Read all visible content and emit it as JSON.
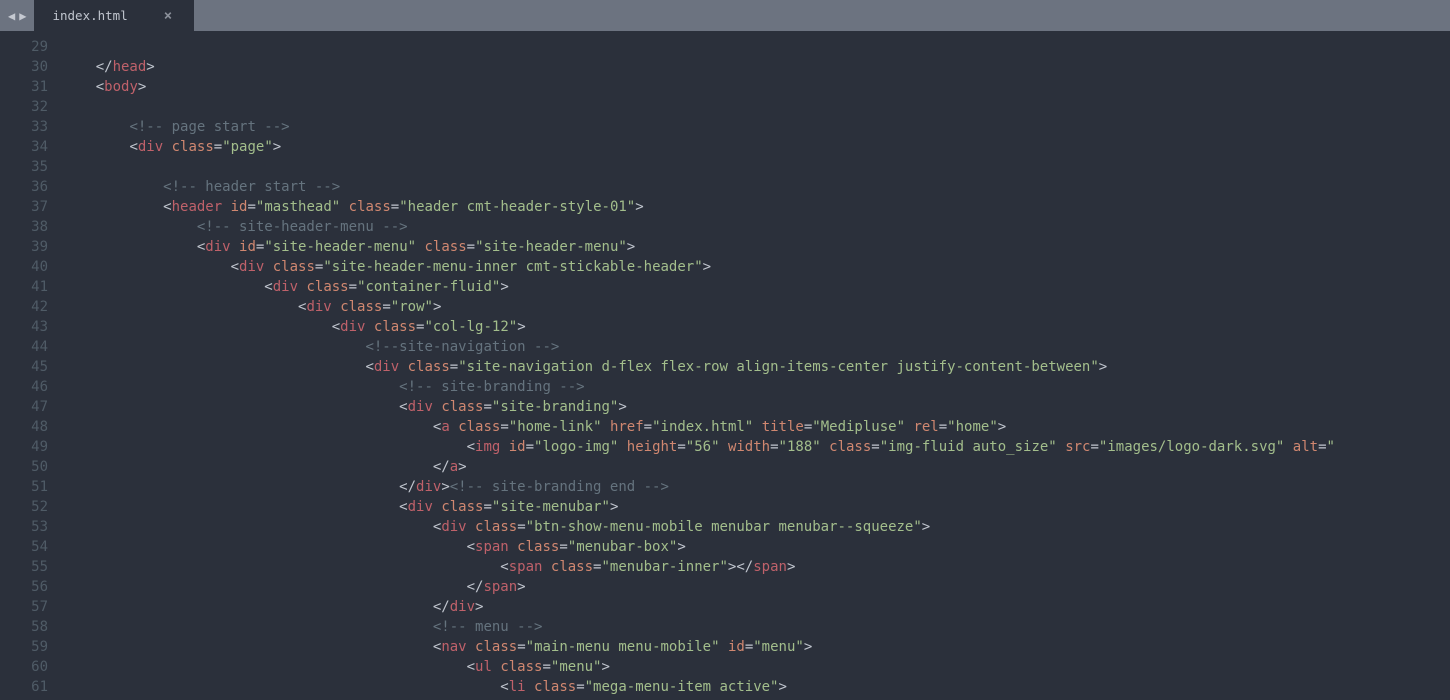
{
  "tab": {
    "title": "index.html"
  },
  "lines": [
    {
      "n": 29,
      "segs": []
    },
    {
      "n": 30,
      "segs": [
        {
          "t": "    ",
          "c": "p"
        },
        {
          "t": "</",
          "c": "p"
        },
        {
          "t": "head",
          "c": "tag"
        },
        {
          "t": ">",
          "c": "p"
        }
      ]
    },
    {
      "n": 31,
      "segs": [
        {
          "t": "    ",
          "c": "p"
        },
        {
          "t": "<",
          "c": "p"
        },
        {
          "t": "body",
          "c": "tag"
        },
        {
          "t": ">",
          "c": "p"
        }
      ]
    },
    {
      "n": 32,
      "segs": []
    },
    {
      "n": 33,
      "segs": [
        {
          "t": "        ",
          "c": "p"
        },
        {
          "t": "<!-- page start -->",
          "c": "cm"
        }
      ]
    },
    {
      "n": 34,
      "segs": [
        {
          "t": "        ",
          "c": "p"
        },
        {
          "t": "<",
          "c": "p"
        },
        {
          "t": "div",
          "c": "tag"
        },
        {
          "t": " ",
          "c": "p"
        },
        {
          "t": "class",
          "c": "attr"
        },
        {
          "t": "=",
          "c": "op"
        },
        {
          "t": "\"page\"",
          "c": "str"
        },
        {
          "t": ">",
          "c": "p"
        }
      ]
    },
    {
      "n": 35,
      "segs": []
    },
    {
      "n": 36,
      "segs": [
        {
          "t": "            ",
          "c": "p"
        },
        {
          "t": "<!-- header start -->",
          "c": "cm"
        }
      ]
    },
    {
      "n": 37,
      "segs": [
        {
          "t": "            ",
          "c": "p"
        },
        {
          "t": "<",
          "c": "p"
        },
        {
          "t": "header",
          "c": "tag"
        },
        {
          "t": " ",
          "c": "p"
        },
        {
          "t": "id",
          "c": "attr"
        },
        {
          "t": "=",
          "c": "op"
        },
        {
          "t": "\"masthead\"",
          "c": "str"
        },
        {
          "t": " ",
          "c": "p"
        },
        {
          "t": "class",
          "c": "attr"
        },
        {
          "t": "=",
          "c": "op"
        },
        {
          "t": "\"header cmt-header-style-01\"",
          "c": "str"
        },
        {
          "t": ">",
          "c": "p"
        }
      ]
    },
    {
      "n": 38,
      "segs": [
        {
          "t": "                ",
          "c": "p"
        },
        {
          "t": "<!-- site-header-menu -->",
          "c": "cm"
        }
      ]
    },
    {
      "n": 39,
      "segs": [
        {
          "t": "                ",
          "c": "p"
        },
        {
          "t": "<",
          "c": "p"
        },
        {
          "t": "div",
          "c": "tag"
        },
        {
          "t": " ",
          "c": "p"
        },
        {
          "t": "id",
          "c": "attr"
        },
        {
          "t": "=",
          "c": "op"
        },
        {
          "t": "\"site-header-menu\"",
          "c": "str"
        },
        {
          "t": " ",
          "c": "p"
        },
        {
          "t": "class",
          "c": "attr"
        },
        {
          "t": "=",
          "c": "op"
        },
        {
          "t": "\"site-header-menu\"",
          "c": "str"
        },
        {
          "t": ">",
          "c": "p"
        }
      ]
    },
    {
      "n": 40,
      "segs": [
        {
          "t": "                    ",
          "c": "p"
        },
        {
          "t": "<",
          "c": "p"
        },
        {
          "t": "div",
          "c": "tag"
        },
        {
          "t": " ",
          "c": "p"
        },
        {
          "t": "class",
          "c": "attr"
        },
        {
          "t": "=",
          "c": "op"
        },
        {
          "t": "\"site-header-menu-inner cmt-stickable-header\"",
          "c": "str"
        },
        {
          "t": ">",
          "c": "p"
        }
      ]
    },
    {
      "n": 41,
      "segs": [
        {
          "t": "                        ",
          "c": "p"
        },
        {
          "t": "<",
          "c": "p"
        },
        {
          "t": "div",
          "c": "tag"
        },
        {
          "t": " ",
          "c": "p"
        },
        {
          "t": "class",
          "c": "attr"
        },
        {
          "t": "=",
          "c": "op"
        },
        {
          "t": "\"container-fluid\"",
          "c": "str"
        },
        {
          "t": ">",
          "c": "p"
        }
      ]
    },
    {
      "n": 42,
      "segs": [
        {
          "t": "                            ",
          "c": "p"
        },
        {
          "t": "<",
          "c": "p"
        },
        {
          "t": "div",
          "c": "tag"
        },
        {
          "t": " ",
          "c": "p"
        },
        {
          "t": "class",
          "c": "attr"
        },
        {
          "t": "=",
          "c": "op"
        },
        {
          "t": "\"row\"",
          "c": "str"
        },
        {
          "t": ">",
          "c": "p"
        }
      ]
    },
    {
      "n": 43,
      "segs": [
        {
          "t": "                                ",
          "c": "p"
        },
        {
          "t": "<",
          "c": "p"
        },
        {
          "t": "div",
          "c": "tag"
        },
        {
          "t": " ",
          "c": "p"
        },
        {
          "t": "class",
          "c": "attr"
        },
        {
          "t": "=",
          "c": "op"
        },
        {
          "t": "\"col-lg-12\"",
          "c": "str"
        },
        {
          "t": ">",
          "c": "p"
        }
      ]
    },
    {
      "n": 44,
      "segs": [
        {
          "t": "                                    ",
          "c": "p"
        },
        {
          "t": "<!--site-navigation -->",
          "c": "cm"
        }
      ]
    },
    {
      "n": 45,
      "segs": [
        {
          "t": "                                    ",
          "c": "p"
        },
        {
          "t": "<",
          "c": "p"
        },
        {
          "t": "div",
          "c": "tag"
        },
        {
          "t": " ",
          "c": "p"
        },
        {
          "t": "class",
          "c": "attr"
        },
        {
          "t": "=",
          "c": "op"
        },
        {
          "t": "\"site-navigation d-flex flex-row align-items-center justify-content-between\"",
          "c": "str"
        },
        {
          "t": ">",
          "c": "p"
        }
      ]
    },
    {
      "n": 46,
      "segs": [
        {
          "t": "                                        ",
          "c": "p"
        },
        {
          "t": "<!-- site-branding -->",
          "c": "cm"
        }
      ]
    },
    {
      "n": 47,
      "segs": [
        {
          "t": "                                        ",
          "c": "p"
        },
        {
          "t": "<",
          "c": "p"
        },
        {
          "t": "div",
          "c": "tag"
        },
        {
          "t": " ",
          "c": "p"
        },
        {
          "t": "class",
          "c": "attr"
        },
        {
          "t": "=",
          "c": "op"
        },
        {
          "t": "\"site-branding\"",
          "c": "str"
        },
        {
          "t": ">",
          "c": "p"
        }
      ]
    },
    {
      "n": 48,
      "segs": [
        {
          "t": "                                            ",
          "c": "p"
        },
        {
          "t": "<",
          "c": "p"
        },
        {
          "t": "a",
          "c": "tag"
        },
        {
          "t": " ",
          "c": "p"
        },
        {
          "t": "class",
          "c": "attr"
        },
        {
          "t": "=",
          "c": "op"
        },
        {
          "t": "\"home-link\"",
          "c": "str"
        },
        {
          "t": " ",
          "c": "p"
        },
        {
          "t": "href",
          "c": "attr"
        },
        {
          "t": "=",
          "c": "op"
        },
        {
          "t": "\"index.html\"",
          "c": "str"
        },
        {
          "t": " ",
          "c": "p"
        },
        {
          "t": "title",
          "c": "attr"
        },
        {
          "t": "=",
          "c": "op"
        },
        {
          "t": "\"Medipluse\"",
          "c": "str"
        },
        {
          "t": " ",
          "c": "p"
        },
        {
          "t": "rel",
          "c": "attr"
        },
        {
          "t": "=",
          "c": "op"
        },
        {
          "t": "\"home\"",
          "c": "str"
        },
        {
          "t": ">",
          "c": "p"
        }
      ]
    },
    {
      "n": 49,
      "segs": [
        {
          "t": "                                                ",
          "c": "p"
        },
        {
          "t": "<",
          "c": "p"
        },
        {
          "t": "img",
          "c": "tag"
        },
        {
          "t": " ",
          "c": "p"
        },
        {
          "t": "id",
          "c": "attr"
        },
        {
          "t": "=",
          "c": "op"
        },
        {
          "t": "\"logo-img\"",
          "c": "str"
        },
        {
          "t": " ",
          "c": "p"
        },
        {
          "t": "height",
          "c": "attr"
        },
        {
          "t": "=",
          "c": "op"
        },
        {
          "t": "\"56\"",
          "c": "str"
        },
        {
          "t": " ",
          "c": "p"
        },
        {
          "t": "width",
          "c": "attr"
        },
        {
          "t": "=",
          "c": "op"
        },
        {
          "t": "\"188\"",
          "c": "str"
        },
        {
          "t": " ",
          "c": "p"
        },
        {
          "t": "class",
          "c": "attr"
        },
        {
          "t": "=",
          "c": "op"
        },
        {
          "t": "\"img-fluid auto_size\"",
          "c": "str"
        },
        {
          "t": " ",
          "c": "p"
        },
        {
          "t": "src",
          "c": "attr"
        },
        {
          "t": "=",
          "c": "op"
        },
        {
          "t": "\"images/logo-dark.svg\"",
          "c": "str"
        },
        {
          "t": " ",
          "c": "p"
        },
        {
          "t": "alt",
          "c": "attr"
        },
        {
          "t": "=",
          "c": "op"
        },
        {
          "t": "\"",
          "c": "str"
        }
      ]
    },
    {
      "n": 50,
      "segs": [
        {
          "t": "                                            ",
          "c": "p"
        },
        {
          "t": "</",
          "c": "p"
        },
        {
          "t": "a",
          "c": "tag"
        },
        {
          "t": ">",
          "c": "p"
        }
      ]
    },
    {
      "n": 51,
      "segs": [
        {
          "t": "                                        ",
          "c": "p"
        },
        {
          "t": "</",
          "c": "p"
        },
        {
          "t": "div",
          "c": "tag"
        },
        {
          "t": ">",
          "c": "p"
        },
        {
          "t": "<!-- site-branding end -->",
          "c": "cm"
        }
      ]
    },
    {
      "n": 52,
      "segs": [
        {
          "t": "                                        ",
          "c": "p"
        },
        {
          "t": "<",
          "c": "p"
        },
        {
          "t": "div",
          "c": "tag"
        },
        {
          "t": " ",
          "c": "p"
        },
        {
          "t": "class",
          "c": "attr"
        },
        {
          "t": "=",
          "c": "op"
        },
        {
          "t": "\"site-menubar\"",
          "c": "str"
        },
        {
          "t": ">",
          "c": "p"
        }
      ]
    },
    {
      "n": 53,
      "segs": [
        {
          "t": "                                            ",
          "c": "p"
        },
        {
          "t": "<",
          "c": "p"
        },
        {
          "t": "div",
          "c": "tag"
        },
        {
          "t": " ",
          "c": "p"
        },
        {
          "t": "class",
          "c": "attr"
        },
        {
          "t": "=",
          "c": "op"
        },
        {
          "t": "\"btn-show-menu-mobile menubar menubar--squeeze\"",
          "c": "str"
        },
        {
          "t": ">",
          "c": "p"
        }
      ]
    },
    {
      "n": 54,
      "segs": [
        {
          "t": "                                                ",
          "c": "p"
        },
        {
          "t": "<",
          "c": "p"
        },
        {
          "t": "span",
          "c": "tag"
        },
        {
          "t": " ",
          "c": "p"
        },
        {
          "t": "class",
          "c": "attr"
        },
        {
          "t": "=",
          "c": "op"
        },
        {
          "t": "\"menubar-box\"",
          "c": "str"
        },
        {
          "t": ">",
          "c": "p"
        }
      ]
    },
    {
      "n": 55,
      "segs": [
        {
          "t": "                                                    ",
          "c": "p"
        },
        {
          "t": "<",
          "c": "p"
        },
        {
          "t": "span",
          "c": "tag"
        },
        {
          "t": " ",
          "c": "p"
        },
        {
          "t": "class",
          "c": "attr"
        },
        {
          "t": "=",
          "c": "op"
        },
        {
          "t": "\"menubar-inner\"",
          "c": "str"
        },
        {
          "t": ">",
          "c": "p"
        },
        {
          "t": "</",
          "c": "p"
        },
        {
          "t": "span",
          "c": "tag"
        },
        {
          "t": ">",
          "c": "p"
        }
      ]
    },
    {
      "n": 56,
      "segs": [
        {
          "t": "                                                ",
          "c": "p"
        },
        {
          "t": "</",
          "c": "p"
        },
        {
          "t": "span",
          "c": "tag"
        },
        {
          "t": ">",
          "c": "p"
        }
      ]
    },
    {
      "n": 57,
      "segs": [
        {
          "t": "                                            ",
          "c": "p"
        },
        {
          "t": "</",
          "c": "p"
        },
        {
          "t": "div",
          "c": "tag"
        },
        {
          "t": ">",
          "c": "p"
        }
      ]
    },
    {
      "n": 58,
      "segs": [
        {
          "t": "                                            ",
          "c": "p"
        },
        {
          "t": "<!-- menu -->",
          "c": "cm"
        }
      ]
    },
    {
      "n": 59,
      "segs": [
        {
          "t": "                                            ",
          "c": "p"
        },
        {
          "t": "<",
          "c": "p"
        },
        {
          "t": "nav",
          "c": "tag"
        },
        {
          "t": " ",
          "c": "p"
        },
        {
          "t": "class",
          "c": "attr"
        },
        {
          "t": "=",
          "c": "op"
        },
        {
          "t": "\"main-menu menu-mobile\"",
          "c": "str"
        },
        {
          "t": " ",
          "c": "p"
        },
        {
          "t": "id",
          "c": "attr"
        },
        {
          "t": "=",
          "c": "op"
        },
        {
          "t": "\"menu\"",
          "c": "str"
        },
        {
          "t": ">",
          "c": "p"
        }
      ]
    },
    {
      "n": 60,
      "segs": [
        {
          "t": "                                                ",
          "c": "p"
        },
        {
          "t": "<",
          "c": "p"
        },
        {
          "t": "ul",
          "c": "tag"
        },
        {
          "t": " ",
          "c": "p"
        },
        {
          "t": "class",
          "c": "attr"
        },
        {
          "t": "=",
          "c": "op"
        },
        {
          "t": "\"menu\"",
          "c": "str"
        },
        {
          "t": ">",
          "c": "p"
        }
      ]
    },
    {
      "n": 61,
      "segs": [
        {
          "t": "                                                    ",
          "c": "p"
        },
        {
          "t": "<",
          "c": "p"
        },
        {
          "t": "li",
          "c": "tag"
        },
        {
          "t": " ",
          "c": "p"
        },
        {
          "t": "class",
          "c": "attr"
        },
        {
          "t": "=",
          "c": "op"
        },
        {
          "t": "\"mega-menu-item active\"",
          "c": "str"
        },
        {
          "t": ">",
          "c": "p"
        }
      ]
    }
  ]
}
